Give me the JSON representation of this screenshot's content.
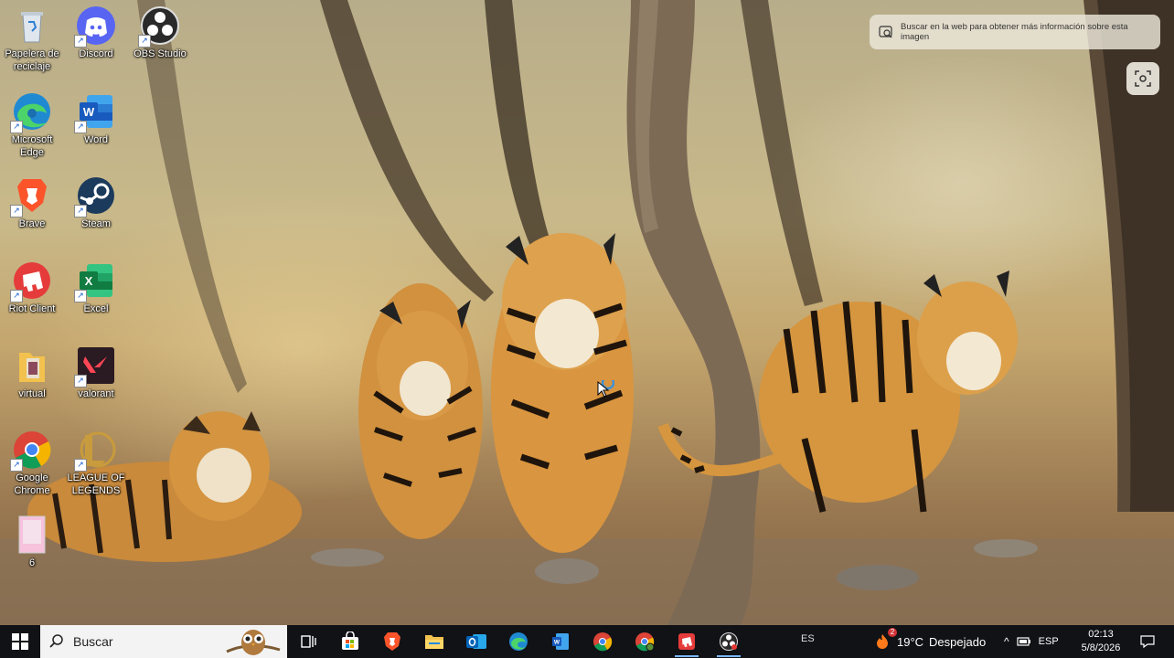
{
  "desktop": {
    "icons": [
      {
        "label": "Papelera de reciclaje",
        "icon": "recycle-bin-icon"
      },
      {
        "label": "Discord",
        "icon": "discord-icon"
      },
      {
        "label": "OBS Studio",
        "icon": "obs-icon"
      },
      {
        "label": "Microsoft Edge",
        "icon": "edge-icon"
      },
      {
        "label": "Word",
        "icon": "word-icon"
      },
      {
        "label": "Brave",
        "icon": "brave-icon"
      },
      {
        "label": "Steam",
        "icon": "steam-icon"
      },
      {
        "label": "Riot Client",
        "icon": "riot-icon"
      },
      {
        "label": "Excel",
        "icon": "excel-icon"
      },
      {
        "label": "virtual",
        "icon": "folder-icon"
      },
      {
        "label": "valorant",
        "icon": "valorant-icon"
      },
      {
        "label": "Google Chrome",
        "icon": "chrome-icon"
      },
      {
        "label": "LEAGUE OF LEGENDS",
        "icon": "league-icon"
      },
      {
        "label": "6",
        "icon": "image-file-icon"
      }
    ]
  },
  "visual_search": {
    "chip_text": "Buscar en la web para obtener más información sobre esta imagen"
  },
  "taskbar": {
    "search_placeholder": "Buscar",
    "apps": [
      "task-view-icon",
      "store-icon",
      "brave-icon",
      "file-explorer-icon",
      "outlook-icon",
      "edge-icon",
      "word-icon",
      "chrome-icon",
      "chrome-alt-icon",
      "riot-icon",
      "obs-icon"
    ],
    "lang_indicator": "ES",
    "weather": {
      "temp": "19°C",
      "condition": "Despejado",
      "badge": "2"
    },
    "keyboard": "ESP",
    "clock": {
      "time": "02:13",
      "date": "5/8/2026"
    }
  },
  "colors": {
    "taskbar_bg": "#101216",
    "accent": "#7bb8ff"
  }
}
